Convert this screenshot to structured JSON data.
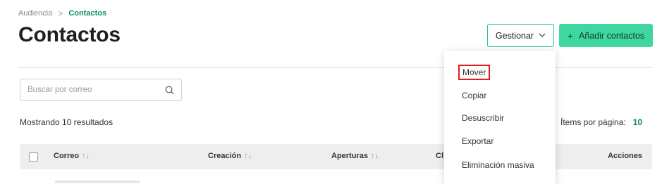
{
  "breadcrumb": {
    "root": "Audiencia",
    "separator": ">",
    "current": "Contactos"
  },
  "page_title": "Contactos",
  "header_buttons": {
    "manage_label": "Gestionar",
    "add_label": "Añadir contactos",
    "add_icon": "+"
  },
  "search": {
    "placeholder": "Buscar por correo",
    "value": ""
  },
  "results": {
    "text": "Mostrando 10 resultados"
  },
  "pagination": {
    "per_page_label": "Ítems por página:",
    "per_page_value": "10"
  },
  "table": {
    "columns": [
      {
        "label": "Correo",
        "sort": "↑↓"
      },
      {
        "label": "Creación",
        "sort": "↑↓"
      },
      {
        "label": "Aperturas",
        "sort": "↑↓"
      },
      {
        "label": "Cl",
        "sort": ""
      },
      {
        "label": "Acciones",
        "sort": ""
      }
    ]
  },
  "manage_menu": {
    "items": [
      {
        "label": "Mover",
        "highlighted": true
      },
      {
        "label": "Copiar"
      },
      {
        "label": "Desuscribir"
      },
      {
        "label": "Exportar"
      },
      {
        "label": "Eliminación masiva"
      }
    ]
  },
  "colors": {
    "accent": "#3fd6a0",
    "accent_dark": "#0f8a66",
    "highlight": "#e01e1e"
  },
  "icons": {
    "search": "search-icon",
    "chevron": "chevron-down-icon",
    "plus": "plus-icon"
  }
}
